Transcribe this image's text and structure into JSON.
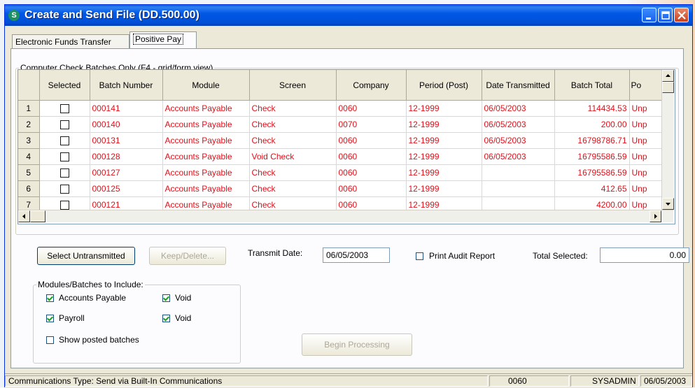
{
  "window": {
    "title": "Create and Send File (DD.500.00)"
  },
  "tabs": [
    {
      "label": "Electronic Funds Transfer"
    },
    {
      "label": "Positive Pay"
    }
  ],
  "grid": {
    "group_label": "Computer Check Batches Only (F4 - grid/form view)",
    "columns": [
      "Selected",
      "Batch Number",
      "Module",
      "Screen",
      "Company",
      "Period (Post)",
      "Date Transmitted",
      "Batch Total",
      "Po"
    ],
    "rows": [
      {
        "n": "1",
        "batch": "000141",
        "module": "Accounts Payable",
        "screen": "Check",
        "company": "0060",
        "period": "12-1999",
        "date": "06/05/2003",
        "total": "114434.53",
        "post": "Unp"
      },
      {
        "n": "2",
        "batch": "000140",
        "module": "Accounts Payable",
        "screen": "Check",
        "company": "0070",
        "period": "12-1999",
        "date": "06/05/2003",
        "total": "200.00",
        "post": "Unp"
      },
      {
        "n": "3",
        "batch": "000131",
        "module": "Accounts Payable",
        "screen": "Check",
        "company": "0060",
        "period": "12-1999",
        "date": "06/05/2003",
        "total": "16798786.71",
        "post": "Unp"
      },
      {
        "n": "4",
        "batch": "000128",
        "module": "Accounts Payable",
        "screen": "Void Check",
        "company": "0060",
        "period": "12-1999",
        "date": "06/05/2003",
        "total": "16795586.59",
        "post": "Unp"
      },
      {
        "n": "5",
        "batch": "000127",
        "module": "Accounts Payable",
        "screen": "Check",
        "company": "0060",
        "period": "12-1999",
        "date": "",
        "total": "16795586.59",
        "post": "Unp"
      },
      {
        "n": "6",
        "batch": "000125",
        "module": "Accounts Payable",
        "screen": "Check",
        "company": "0060",
        "period": "12-1999",
        "date": "",
        "total": "412.65",
        "post": "Unp"
      },
      {
        "n": "7",
        "batch": "000121",
        "module": "Accounts Payable",
        "screen": "Check",
        "company": "0060",
        "period": "12-1999",
        "date": "",
        "total": "4200.00",
        "post": "Unp"
      }
    ]
  },
  "controls": {
    "select_untransmitted": "Select Untransmitted",
    "keep_delete": "Keep/Delete...",
    "transmit_date_label": "Transmit Date:",
    "transmit_date": "06/05/2003",
    "print_audit": "Print Audit Report",
    "total_selected_label": "Total Selected:",
    "total_selected": "0.00",
    "begin_processing": "Begin Processing"
  },
  "modules": {
    "group_label": "Modules/Batches to Include:",
    "accounts_payable": "Accounts Payable",
    "void1": "Void",
    "payroll": "Payroll",
    "void2": "Void",
    "show_posted": "Show posted batches"
  },
  "status": {
    "comm_type": "Communications Type: Send via Built-In Communications",
    "company": "0060",
    "user": "SYSADMIN",
    "date": "06/05/2003"
  },
  "colors": {
    "row_text": "#e0101a",
    "titlebar": "#0058e6"
  }
}
